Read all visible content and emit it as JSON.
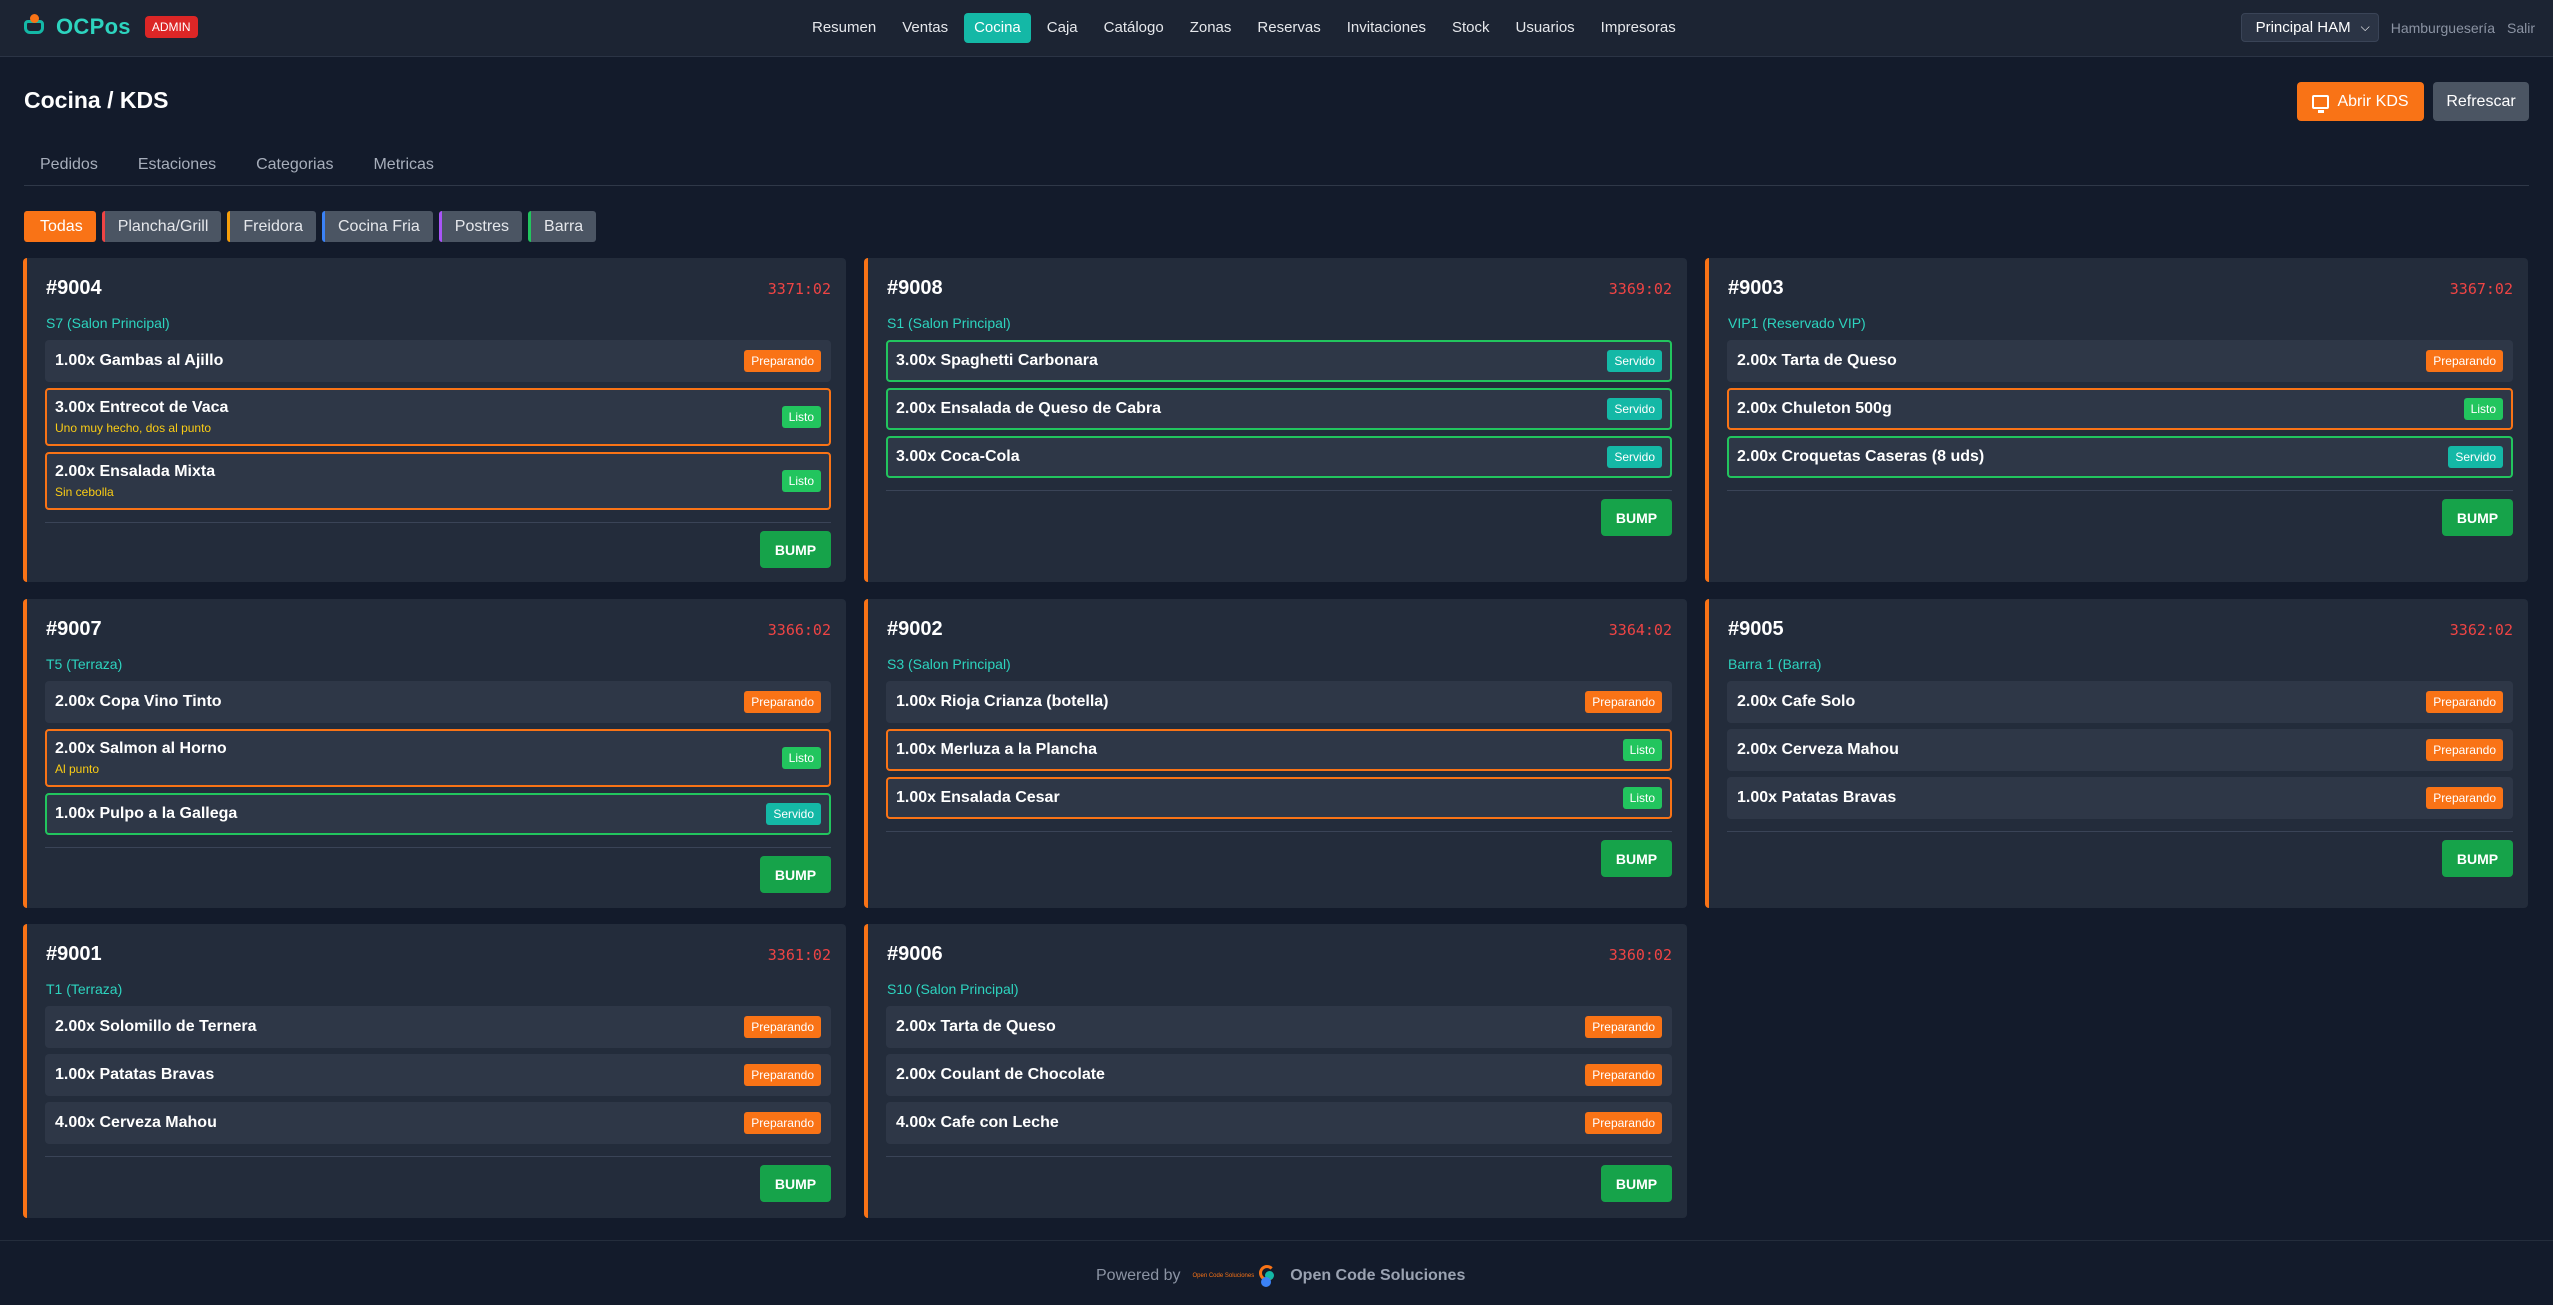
{
  "brand": {
    "name": "OCPos",
    "badge": "ADMIN"
  },
  "nav": {
    "links": [
      "Resumen",
      "Ventas",
      "Cocina",
      "Caja",
      "Catálogo",
      "Zonas",
      "Reservas",
      "Invitaciones",
      "Stock",
      "Usuarios",
      "Impresoras"
    ],
    "active": "Cocina",
    "branch": "Principal HAM",
    "business": "Hamburguesería",
    "logout": "Salir"
  },
  "page": {
    "title": "Cocina / KDS",
    "open_kds_label": "Abrir KDS",
    "refresh_label": "Refrescar"
  },
  "tabs": [
    "Pedidos",
    "Estaciones",
    "Categorias",
    "Metricas"
  ],
  "filters": [
    {
      "label": "Todas",
      "color": "#f97316"
    },
    {
      "label": "Plancha/Grill",
      "color": "#ef4444"
    },
    {
      "label": "Freidora",
      "color": "#f59e0b"
    },
    {
      "label": "Cocina Fria",
      "color": "#3b82f6"
    },
    {
      "label": "Postres",
      "color": "#a855f7"
    },
    {
      "label": "Barra",
      "color": "#22c55e"
    }
  ],
  "status_labels": {
    "prep": "Preparando",
    "listo": "Listo",
    "servido": "Servido"
  },
  "bump_label": "BUMP",
  "orders": [
    {
      "id": "#9004",
      "timer": "3371:02",
      "table": "S7 (Salon Principal)",
      "items": [
        {
          "name": "1.00x Gambas al Ajillo",
          "status": "prep"
        },
        {
          "name": "3.00x Entrecot de Vaca",
          "note": "Uno muy hecho, dos al punto",
          "status": "listo"
        },
        {
          "name": "2.00x Ensalada Mixta",
          "note": "Sin cebolla",
          "status": "listo"
        }
      ]
    },
    {
      "id": "#9008",
      "timer": "3369:02",
      "table": "S1 (Salon Principal)",
      "items": [
        {
          "name": "3.00x Spaghetti Carbonara",
          "status": "servido"
        },
        {
          "name": "2.00x Ensalada de Queso de Cabra",
          "status": "servido"
        },
        {
          "name": "3.00x Coca-Cola",
          "status": "servido"
        }
      ]
    },
    {
      "id": "#9003",
      "timer": "3367:02",
      "table": "VIP1 (Reservado VIP)",
      "items": [
        {
          "name": "2.00x Tarta de Queso",
          "status": "prep"
        },
        {
          "name": "2.00x Chuleton 500g",
          "status": "listo"
        },
        {
          "name": "2.00x Croquetas Caseras (8 uds)",
          "status": "servido"
        }
      ]
    },
    {
      "id": "#9007",
      "timer": "3366:02",
      "table": "T5 (Terraza)",
      "items": [
        {
          "name": "2.00x Copa Vino Tinto",
          "status": "prep"
        },
        {
          "name": "2.00x Salmon al Horno",
          "note": "Al punto",
          "status": "listo"
        },
        {
          "name": "1.00x Pulpo a la Gallega",
          "status": "servido"
        }
      ]
    },
    {
      "id": "#9002",
      "timer": "3364:02",
      "table": "S3 (Salon Principal)",
      "items": [
        {
          "name": "1.00x Rioja Crianza (botella)",
          "status": "prep"
        },
        {
          "name": "1.00x Merluza a la Plancha",
          "status": "listo"
        },
        {
          "name": "1.00x Ensalada Cesar",
          "status": "listo"
        }
      ]
    },
    {
      "id": "#9005",
      "timer": "3362:02",
      "table": "Barra 1 (Barra)",
      "items": [
        {
          "name": "2.00x Cafe Solo",
          "status": "prep"
        },
        {
          "name": "2.00x Cerveza Mahou",
          "status": "prep"
        },
        {
          "name": "1.00x Patatas Bravas",
          "status": "prep"
        }
      ]
    },
    {
      "id": "#9001",
      "timer": "3361:02",
      "table": "T1 (Terraza)",
      "items": [
        {
          "name": "2.00x Solomillo de Ternera",
          "status": "prep"
        },
        {
          "name": "1.00x Patatas Bravas",
          "status": "prep"
        },
        {
          "name": "4.00x Cerveza Mahou",
          "status": "prep"
        }
      ]
    },
    {
      "id": "#9006",
      "timer": "3360:02",
      "table": "S10 (Salon Principal)",
      "items": [
        {
          "name": "2.00x Tarta de Queso",
          "status": "prep"
        },
        {
          "name": "2.00x Coulant de Chocolate",
          "status": "prep"
        },
        {
          "name": "4.00x Cafe con Leche",
          "status": "prep"
        }
      ]
    }
  ],
  "footer": {
    "powered": "Powered by",
    "logo_text": "Open Code Soluciones",
    "company": "Open Code Soluciones"
  }
}
